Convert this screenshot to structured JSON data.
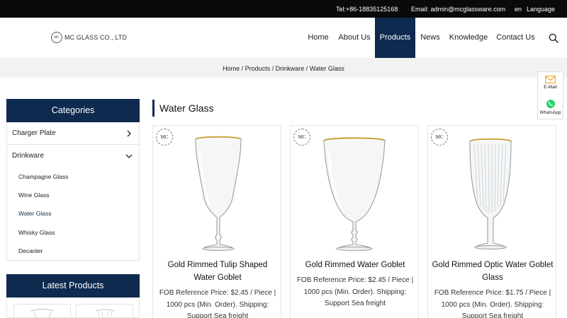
{
  "topbar": {
    "phone": "Tel:+86-18835125168",
    "email": "Email: admin@mcglassware.com",
    "lang": "en",
    "language_label": "Language"
  },
  "header": {
    "logo_badge": "MC",
    "logo_text": "MC GLASS CO., LTD",
    "nav": [
      "Home",
      "About Us",
      "Products",
      "News",
      "Knowledge",
      "Contact Us"
    ],
    "active_nav": "Products"
  },
  "breadcrumb": "Home / Products / Drinkware / Water Glass",
  "sidebar": {
    "categories_title": "Categories",
    "categories": [
      {
        "label": "Charger Plate",
        "expanded": false
      },
      {
        "label": "Drinkware",
        "expanded": true
      }
    ],
    "subitems": [
      "Champagne Glass",
      "Wine Glass",
      "Water Glass",
      "Whisky Glass",
      "Decanter"
    ],
    "active_subitem": "Water Glass",
    "latest_title": "Latest Products"
  },
  "main": {
    "title": "Water Glass",
    "products": [
      {
        "badge": "MC",
        "title": "Gold Rimmed Tulip Shaped Water Goblet",
        "desc": "FOB Reference Price: $2.45 / Piece | 1000 pcs (Min. Order). Shipping: Support Sea freight"
      },
      {
        "badge": "MC",
        "title": "Gold Rimmed Water Goblet",
        "desc": "FOB Reference Price: $2.45 / Piece | 1000 pcs (Min. Order). Shipping: Support Sea freight"
      },
      {
        "badge": "MC",
        "title": "Gold Rimmed Optic Water Goblet Glass",
        "desc": "FOB Reference Price: $1.75 / Piece | 1000 pcs (Min. Order). Shipping: Support Sea freight"
      }
    ]
  },
  "float": {
    "email_label": "E-Mail",
    "whatsapp_label": "WhatsApp"
  },
  "colors": {
    "navy": "#0f2a4f",
    "topbar": "#0a0a0a",
    "gold": "#c9a444",
    "whatsapp": "#25d366",
    "mail": "#f0a830"
  },
  "icons": [
    "search-icon",
    "chevron-right-icon",
    "chevron-down-icon",
    "mail-icon",
    "whatsapp-icon"
  ]
}
